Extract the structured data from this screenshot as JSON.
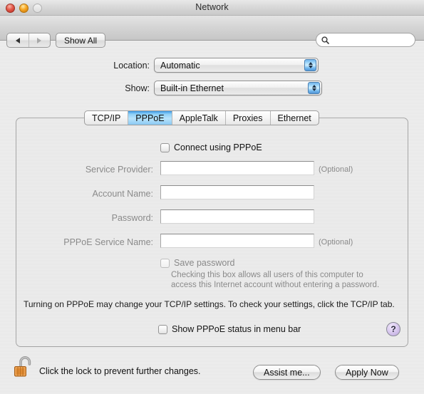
{
  "window": {
    "title": "Network",
    "traffic_lights": [
      "close",
      "minimize",
      "zoom"
    ]
  },
  "toolbar": {
    "back_icon": "back-arrow",
    "forward_icon": "forward-arrow",
    "show_all_label": "Show All",
    "search_placeholder": "",
    "search_value": "",
    "search_icon": "search-icon"
  },
  "settings": {
    "location_label": "Location:",
    "location_value": "Automatic",
    "show_label": "Show:",
    "show_value": "Built-in Ethernet"
  },
  "tabs": [
    {
      "label": "TCP/IP",
      "selected": false
    },
    {
      "label": "PPPoE",
      "selected": true
    },
    {
      "label": "AppleTalk",
      "selected": false
    },
    {
      "label": "Proxies",
      "selected": false
    },
    {
      "label": "Ethernet",
      "selected": false
    }
  ],
  "pppoe": {
    "connect_checkbox_label": "Connect using PPPoE",
    "connect_checked": false,
    "fields": [
      {
        "label": "Service Provider:",
        "value": "",
        "optional_note": "(Optional)"
      },
      {
        "label": "Account Name:",
        "value": "",
        "optional_note": ""
      },
      {
        "label": "Password:",
        "value": "",
        "optional_note": ""
      },
      {
        "label": "PPPoE Service Name:",
        "value": "",
        "optional_note": "(Optional)"
      }
    ],
    "save_password_label": "Save password",
    "save_password_help_line1": "Checking this box allows all users of this computer to",
    "save_password_help_line2": "access this Internet account without entering a password.",
    "notice": "Turning on PPPoE may change your TCP/IP settings. To check your settings, click the TCP/IP tab.",
    "status_menu_label": "Show PPPoE status in menu bar",
    "help_button_label": "?"
  },
  "footer": {
    "lock_icon": "unlocked-padlock-icon",
    "lock_text": "Click the lock to prevent further changes.",
    "assist_label": "Assist me...",
    "apply_label": "Apply Now"
  },
  "colors": {
    "selected_tab_blue": "#8fd0f7",
    "popup_arrow_blue": "#4f95d8",
    "help_purple": "#b9a3db",
    "lock_body_orange": "#e08a33",
    "disabled_text": "#8a8a8a"
  }
}
